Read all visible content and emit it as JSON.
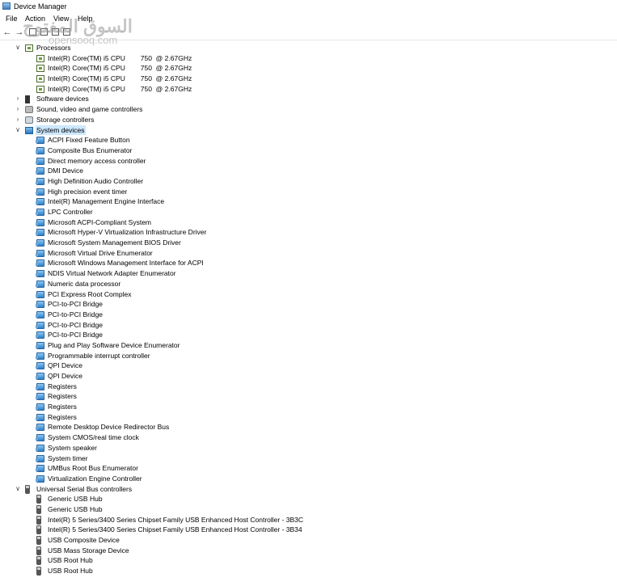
{
  "window": {
    "title": "Device Manager"
  },
  "menu": [
    "File",
    "Action",
    "View",
    "Help"
  ],
  "watermark": {
    "text": "السوق المفتوح",
    "sub": "opensooq.com"
  },
  "tree": [
    {
      "label": "Processors",
      "level": 1,
      "icon": "cpu-icon",
      "expanded": true
    },
    {
      "label": "Intel(R) Core(TM) i5 CPU        750  @ 2.67GHz",
      "level": 2,
      "icon": "cpu-icon"
    },
    {
      "label": "Intel(R) Core(TM) i5 CPU        750  @ 2.67GHz",
      "level": 2,
      "icon": "cpu-icon"
    },
    {
      "label": "Intel(R) Core(TM) i5 CPU        750  @ 2.67GHz",
      "level": 2,
      "icon": "cpu-icon"
    },
    {
      "label": "Intel(R) Core(TM) i5 CPU        750  @ 2.67GHz",
      "level": 2,
      "icon": "cpu-icon"
    },
    {
      "label": "Software devices",
      "level": 1,
      "icon": "software-icon",
      "expanded": false
    },
    {
      "label": "Sound, video and game controllers",
      "level": 1,
      "icon": "sound-icon",
      "expanded": false
    },
    {
      "label": "Storage controllers",
      "level": 1,
      "icon": "storage-icon",
      "expanded": false
    },
    {
      "label": "System devices",
      "level": 1,
      "icon": "system-folder-icon",
      "expanded": true,
      "selected": true
    },
    {
      "label": "ACPI Fixed Feature Button",
      "level": 2,
      "icon": "system-device-icon"
    },
    {
      "label": "Composite Bus Enumerator",
      "level": 2,
      "icon": "system-device-icon"
    },
    {
      "label": "Direct memory access controller",
      "level": 2,
      "icon": "system-device-icon"
    },
    {
      "label": "DMI Device",
      "level": 2,
      "icon": "system-device-icon"
    },
    {
      "label": "High Definition Audio Controller",
      "level": 2,
      "icon": "system-device-icon"
    },
    {
      "label": "High precision event timer",
      "level": 2,
      "icon": "system-device-icon"
    },
    {
      "label": "Intel(R) Management Engine Interface",
      "level": 2,
      "icon": "system-device-icon"
    },
    {
      "label": "LPC Controller",
      "level": 2,
      "icon": "system-device-icon"
    },
    {
      "label": "Microsoft ACPI-Compliant System",
      "level": 2,
      "icon": "system-device-icon"
    },
    {
      "label": "Microsoft Hyper-V Virtualization Infrastructure Driver",
      "level": 2,
      "icon": "system-device-icon"
    },
    {
      "label": "Microsoft System Management BIOS Driver",
      "level": 2,
      "icon": "system-device-icon"
    },
    {
      "label": "Microsoft Virtual Drive Enumerator",
      "level": 2,
      "icon": "system-device-icon"
    },
    {
      "label": "Microsoft Windows Management Interface for ACPI",
      "level": 2,
      "icon": "system-device-icon"
    },
    {
      "label": "NDIS Virtual Network Adapter Enumerator",
      "level": 2,
      "icon": "system-device-icon"
    },
    {
      "label": "Numeric data processor",
      "level": 2,
      "icon": "system-device-icon"
    },
    {
      "label": "PCI Express Root Complex",
      "level": 2,
      "icon": "system-device-icon"
    },
    {
      "label": "PCI-to-PCI Bridge",
      "level": 2,
      "icon": "system-device-icon"
    },
    {
      "label": "PCI-to-PCI Bridge",
      "level": 2,
      "icon": "system-device-icon"
    },
    {
      "label": "PCI-to-PCI Bridge",
      "level": 2,
      "icon": "system-device-icon"
    },
    {
      "label": "PCI-to-PCI Bridge",
      "level": 2,
      "icon": "system-device-icon"
    },
    {
      "label": "Plug and Play Software Device Enumerator",
      "level": 2,
      "icon": "system-device-icon"
    },
    {
      "label": "Programmable interrupt controller",
      "level": 2,
      "icon": "system-device-icon"
    },
    {
      "label": "QPI Device",
      "level": 2,
      "icon": "system-device-icon"
    },
    {
      "label": "QPI Device",
      "level": 2,
      "icon": "system-device-icon"
    },
    {
      "label": "Registers",
      "level": 2,
      "icon": "system-device-icon"
    },
    {
      "label": "Registers",
      "level": 2,
      "icon": "system-device-icon"
    },
    {
      "label": "Registers",
      "level": 2,
      "icon": "system-device-icon"
    },
    {
      "label": "Registers",
      "level": 2,
      "icon": "system-device-icon"
    },
    {
      "label": "Remote Desktop Device Redirector Bus",
      "level": 2,
      "icon": "system-device-icon"
    },
    {
      "label": "System CMOS/real time clock",
      "level": 2,
      "icon": "system-device-icon"
    },
    {
      "label": "System speaker",
      "level": 2,
      "icon": "system-device-icon"
    },
    {
      "label": "System timer",
      "level": 2,
      "icon": "system-device-icon"
    },
    {
      "label": "UMBus Root Bus Enumerator",
      "level": 2,
      "icon": "system-device-icon"
    },
    {
      "label": "Virtualization Engine Controller",
      "level": 2,
      "icon": "system-device-icon"
    },
    {
      "label": "Universal Serial Bus controllers",
      "level": 1,
      "icon": "usb-icon",
      "expanded": true
    },
    {
      "label": "Generic USB Hub",
      "level": 2,
      "icon": "usb-icon"
    },
    {
      "label": "Generic USB Hub",
      "level": 2,
      "icon": "usb-icon"
    },
    {
      "label": "Intel(R) 5 Series/3400 Series Chipset Family USB Enhanced Host Controller - 3B3C",
      "level": 2,
      "icon": "usb-icon"
    },
    {
      "label": "Intel(R) 5 Series/3400 Series Chipset Family USB Enhanced Host Controller - 3B34",
      "level": 2,
      "icon": "usb-icon"
    },
    {
      "label": "USB Composite Device",
      "level": 2,
      "icon": "usb-icon"
    },
    {
      "label": "USB Mass Storage Device",
      "level": 2,
      "icon": "usb-icon"
    },
    {
      "label": "USB Root Hub",
      "level": 2,
      "icon": "usb-icon"
    },
    {
      "label": "USB Root Hub",
      "level": 2,
      "icon": "usb-icon"
    }
  ]
}
